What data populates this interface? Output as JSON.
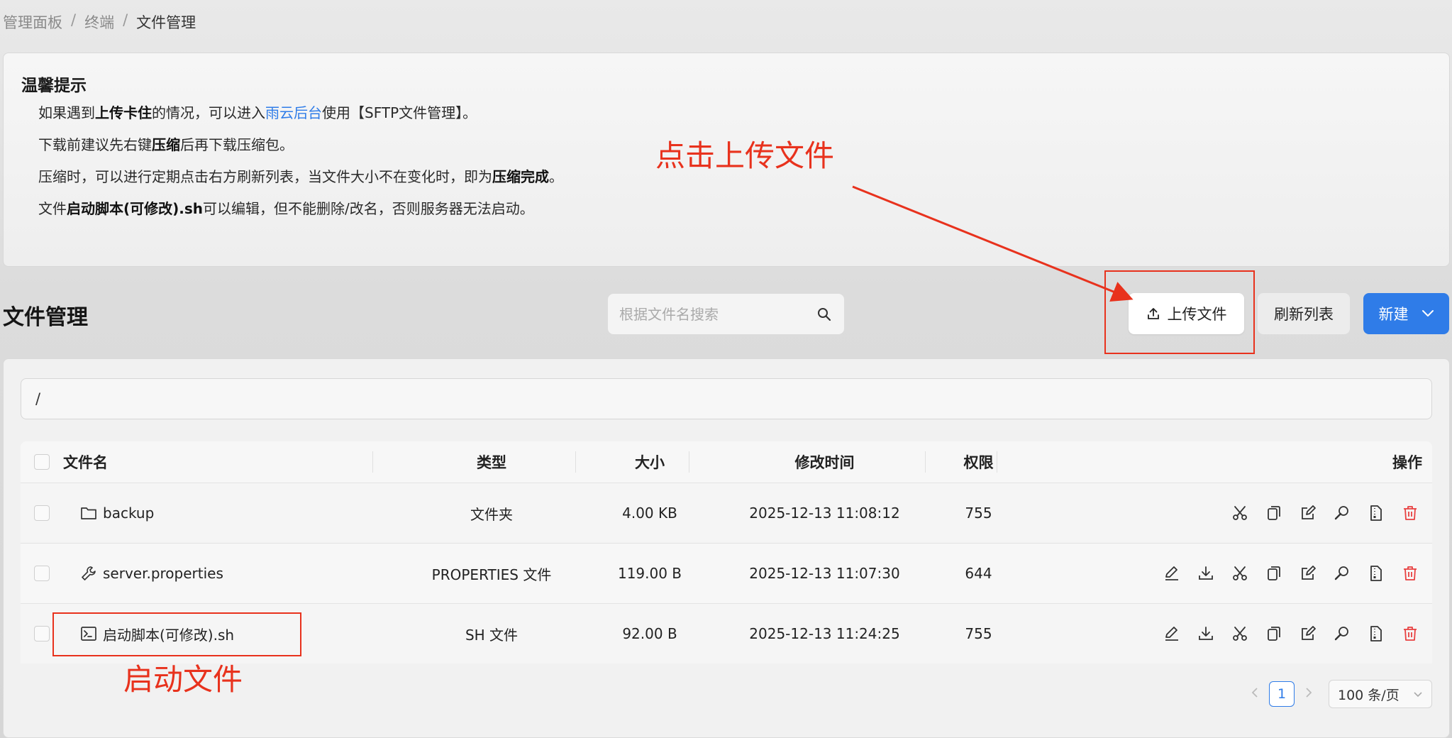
{
  "breadcrumb": [
    "管理面板",
    "终端",
    "文件管理"
  ],
  "breadcrumb_sep": "/",
  "notice": {
    "title": "温馨提示",
    "line1": {
      "a": "如果遇到",
      "b": "上传卡住",
      "c": "的情况，可以进入",
      "link": "雨云后台",
      "d": "使用【SFTP文件管理】。"
    },
    "line2": {
      "a": "下载前建议先右键",
      "b": "压缩",
      "c": "后再下载压缩包。"
    },
    "line3": {
      "a": "压缩时，可以进行定期点击右方刷新列表，当文件大小不在变化时，即为",
      "b": "压缩完成",
      "c": "。"
    },
    "line4": {
      "a": "文件",
      "b": "启动脚本(可修改).sh",
      "c": "可以编辑，但不能删除/改名，否则服务器无法启动。"
    }
  },
  "annotations": {
    "upload": "点击上传文件",
    "start_file": "启动文件"
  },
  "section_title": "文件管理",
  "search": {
    "placeholder": "根据文件名搜索"
  },
  "buttons": {
    "upload": "上传文件",
    "refresh": "刷新列表",
    "new": "新建"
  },
  "path": "/",
  "table": {
    "headers": {
      "name": "文件名",
      "type": "类型",
      "size": "大小",
      "time": "修改时间",
      "perm": "权限",
      "ops": "操作"
    },
    "rows": [
      {
        "name": "backup",
        "type": "文件夹",
        "size": "4.00 KB",
        "time": "2025-12-13 11:08:12",
        "perm": "755",
        "icon": "folder-icon"
      },
      {
        "name": "server.properties",
        "type": "PROPERTIES 文件",
        "size": "119.00 B",
        "time": "2025-12-13 11:07:30",
        "perm": "644",
        "icon": "wrench-icon"
      },
      {
        "name": "启动脚本(可修改).sh",
        "type": "SH 文件",
        "size": "92.00 B",
        "time": "2025-12-13 11:24:25",
        "perm": "755",
        "icon": "terminal-icon"
      }
    ]
  },
  "pagination": {
    "current": "1",
    "page_size": "100 条/页"
  },
  "colors": {
    "accent": "#2f7ce8",
    "annotation_red": "#e8321d",
    "danger": "#e84040"
  }
}
